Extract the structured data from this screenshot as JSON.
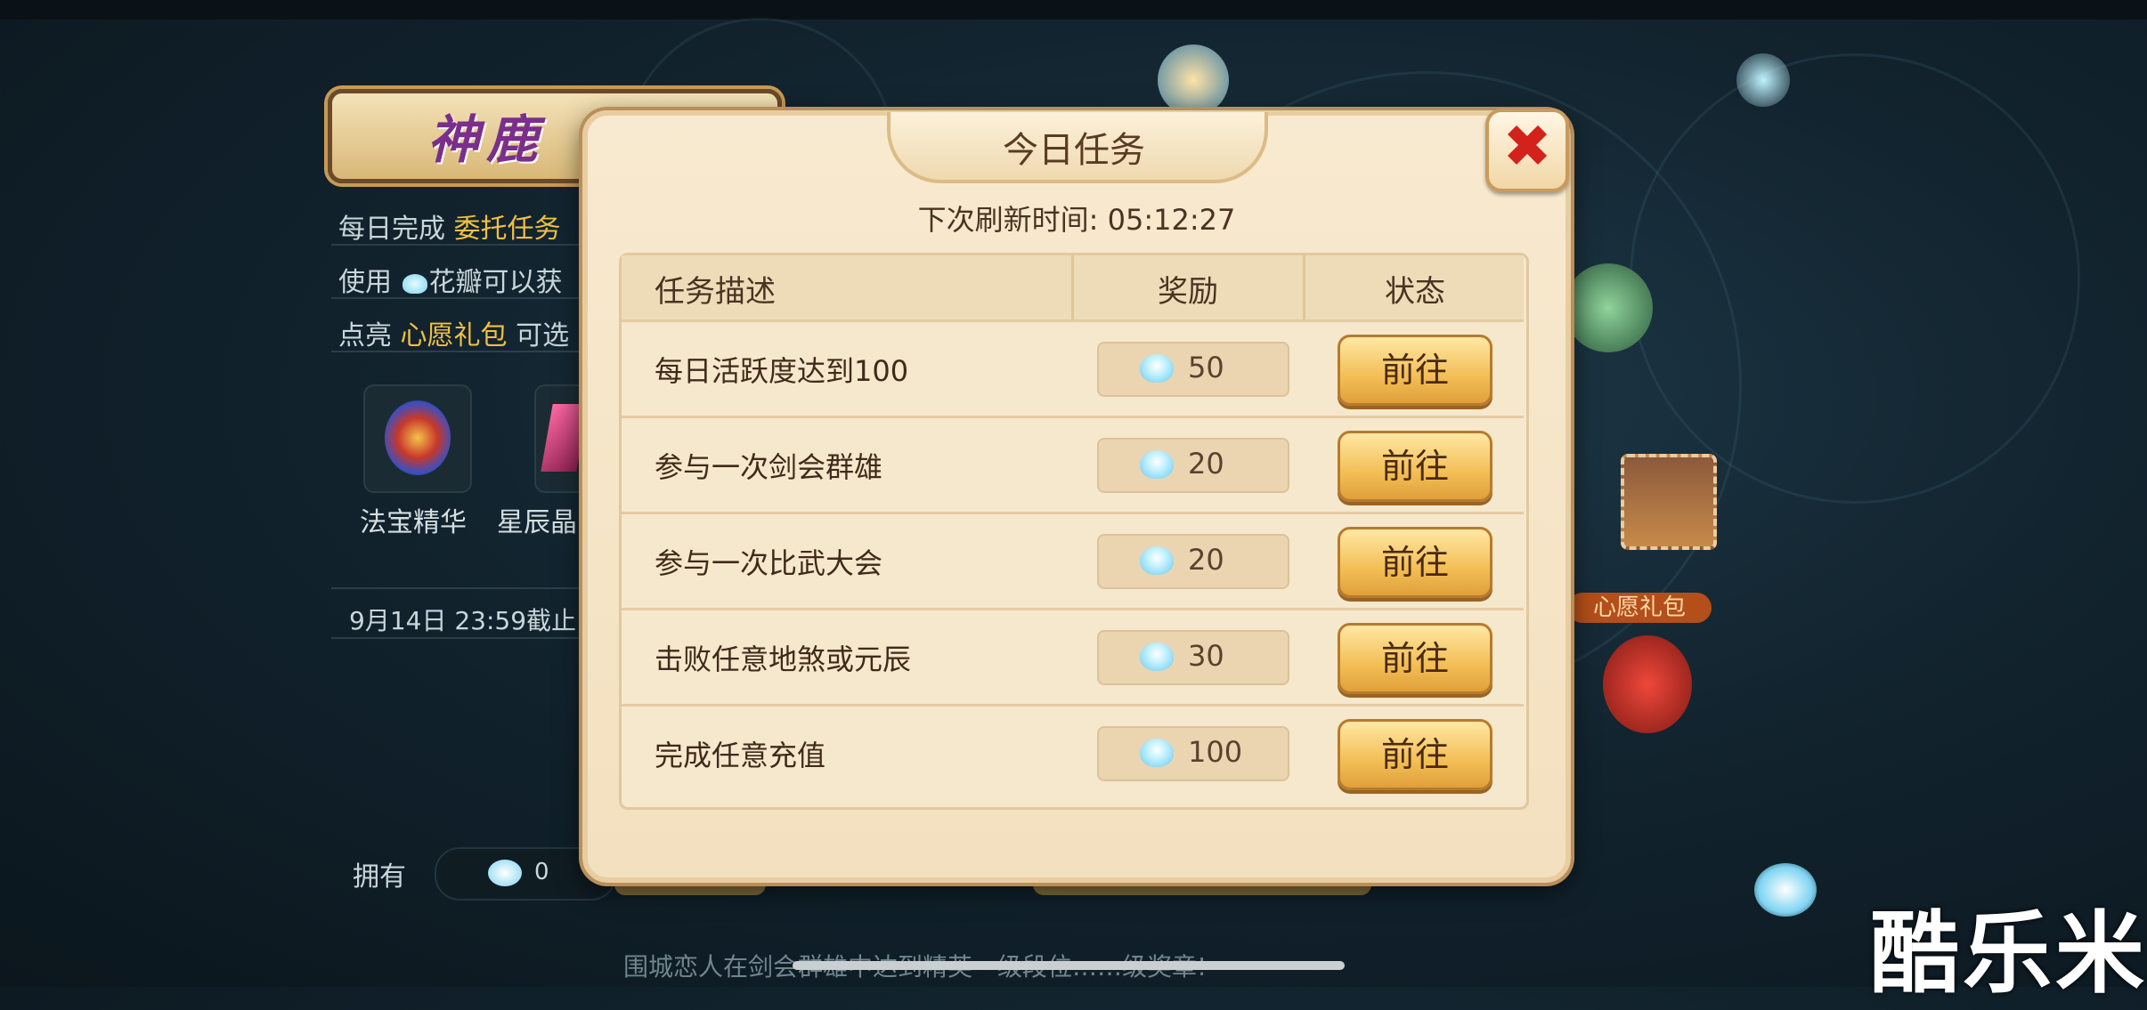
{
  "background": {
    "banner_title": "神鹿",
    "lines": [
      {
        "pre": "每日完成 ",
        "hl": "委托任务",
        "post": ""
      },
      {
        "pre": "使用 ",
        "hl": "",
        "post": "花瓣可以获"
      },
      {
        "pre": "点亮 ",
        "hl": "心愿礼包",
        "post": " 可选"
      }
    ],
    "items": [
      "法宝精华",
      "星辰晶"
    ],
    "deadline": "9月14日  23:59截止",
    "own_label": "拥有",
    "own_count": "0",
    "wish_label": "心愿礼包",
    "bottom_note": "围城恋人在剑会群雄中达到精英一级段位……级奖章!",
    "watermark": "酷乐米"
  },
  "dialog": {
    "title": "今日任务",
    "close_label": "✖",
    "refresh_text": "下次刷新时间: 05:12:27",
    "headers": {
      "task": "任务描述",
      "reward": "奖励",
      "status": "状态"
    },
    "rows": [
      {
        "task": "每日活跃度达到100",
        "reward": "50",
        "action": "前往"
      },
      {
        "task": "参与一次剑会群雄",
        "reward": "20",
        "action": "前往"
      },
      {
        "task": "参与一次比武大会",
        "reward": "20",
        "action": "前往"
      },
      {
        "task": "击败任意地煞或元辰",
        "reward": "30",
        "action": "前往"
      },
      {
        "task": "完成任意充值",
        "reward": "100",
        "action": "前往"
      }
    ]
  },
  "colors": {
    "accent": "#f3be55",
    "close": "#d3221b",
    "highlight": "#f0c043"
  }
}
